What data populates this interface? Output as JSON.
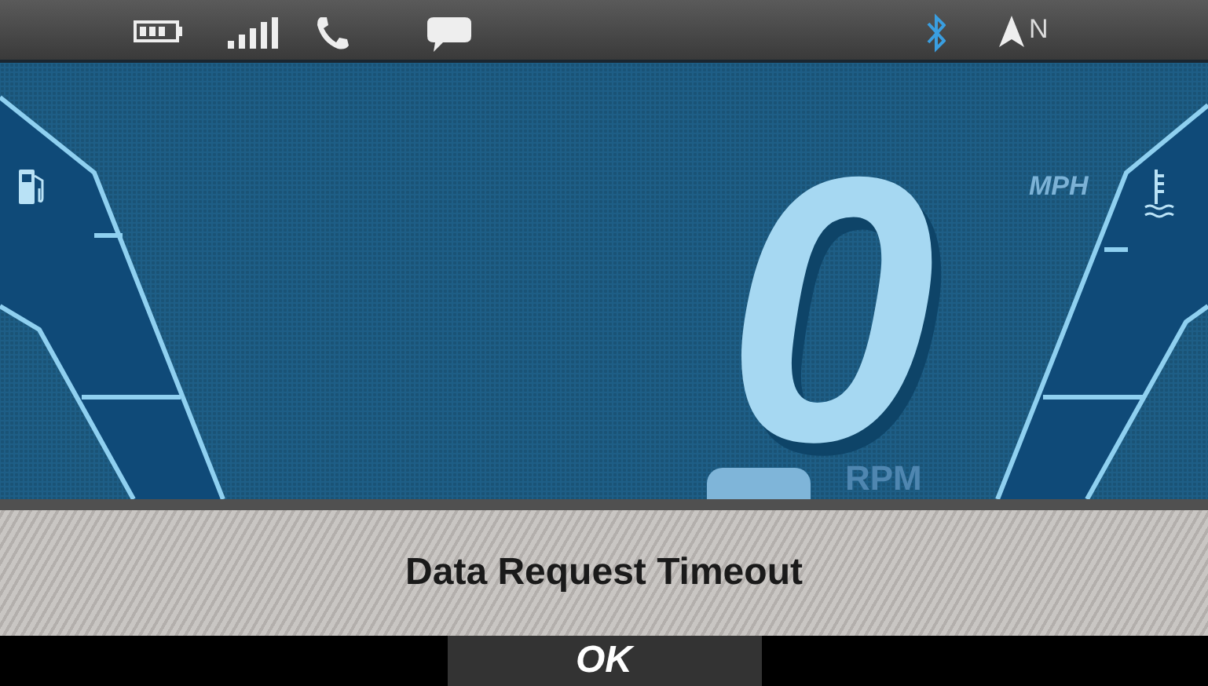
{
  "status_bar": {
    "heading": "N"
  },
  "speedometer": {
    "speed": "0",
    "unit": "MPH"
  },
  "tachometer": {
    "label": "RPM"
  },
  "dialog": {
    "message": "Data Request Timeout",
    "buttons": [
      "OK"
    ]
  }
}
